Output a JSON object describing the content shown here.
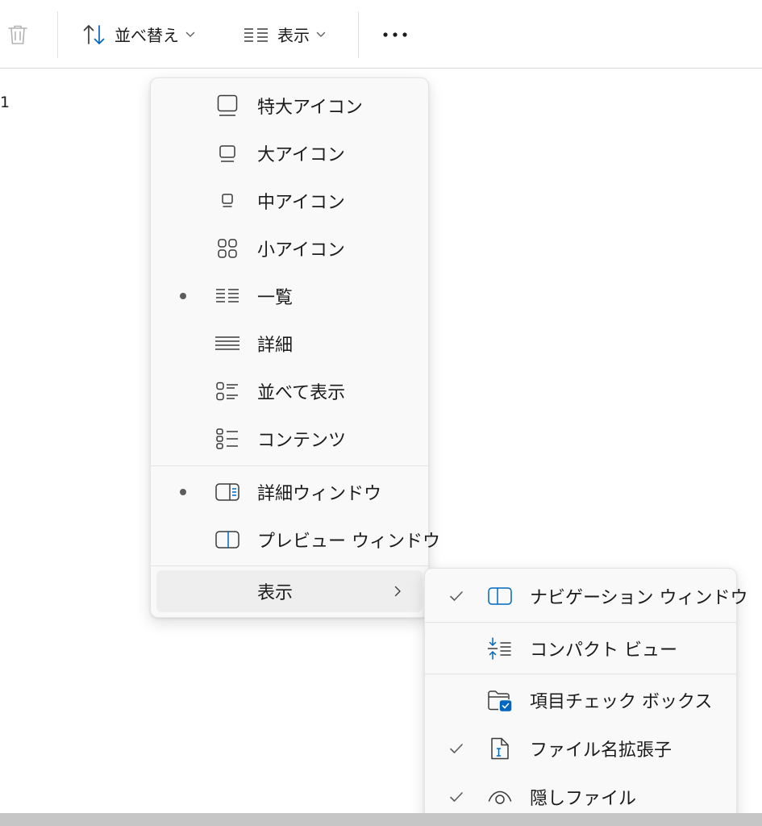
{
  "toolbar": {
    "sort_label": "並べ替え",
    "view_label": "表示"
  },
  "page_number": "1",
  "view_menu": {
    "items": [
      {
        "label": "特大アイコン"
      },
      {
        "label": "大アイコン"
      },
      {
        "label": "中アイコン"
      },
      {
        "label": "小アイコン"
      },
      {
        "label": "一覧",
        "selected": true
      },
      {
        "label": "詳細"
      },
      {
        "label": "並べて表示"
      },
      {
        "label": "コンテンツ"
      }
    ],
    "pane_items": [
      {
        "label": "詳細ウィンドウ",
        "selected": true
      },
      {
        "label": "プレビュー ウィンドウ"
      }
    ],
    "show_item": {
      "label": "表示"
    }
  },
  "show_submenu": {
    "items": [
      {
        "label": "ナビゲーション ウィンドウ",
        "checked": true
      },
      {
        "label": "コンパクト ビュー",
        "checked": false
      },
      {
        "label": "項目チェック ボックス",
        "checked": false
      },
      {
        "label": "ファイル名拡張子",
        "checked": true
      },
      {
        "label": "隠しファイル",
        "checked": true
      }
    ]
  },
  "colors": {
    "accent": "#0067c0",
    "menu_bg": "#f9f9f9",
    "text": "#1b1b1b"
  }
}
